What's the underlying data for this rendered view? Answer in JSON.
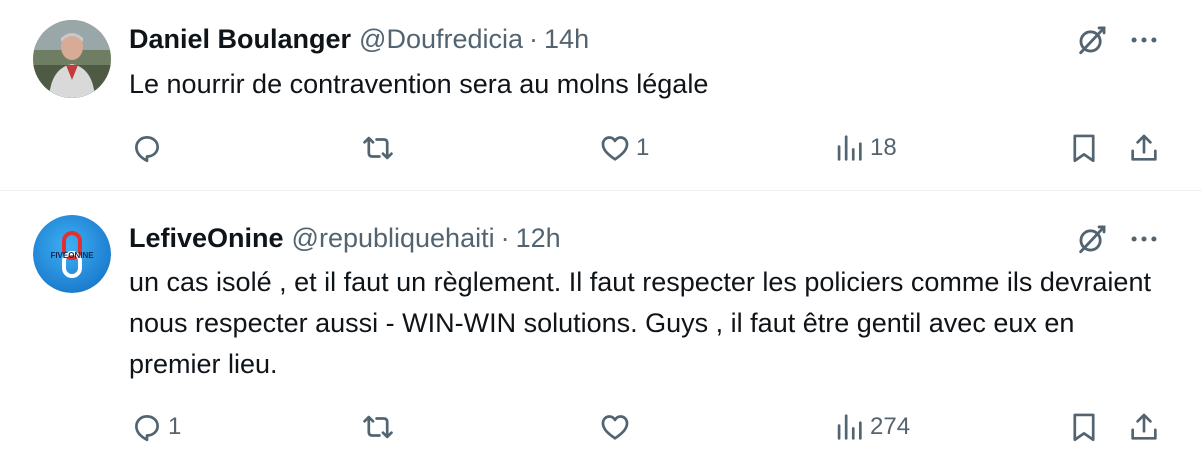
{
  "tweets": [
    {
      "display_name": "Daniel Boulanger",
      "handle": "@Doufredicia",
      "separator": "·",
      "time": "14h",
      "text": "Le nourrir de contravention sera au molns légale",
      "replies": "",
      "retweets": "",
      "likes": "1",
      "views": "18"
    },
    {
      "display_name": "LefiveOnine",
      "handle": "@republiquehaiti",
      "separator": "·",
      "time": "12h",
      "text": "un cas isolé , et il faut un règlement. Il faut respecter les policiers comme ils devraient nous respecter aussi - WIN-WIN solutions. Guys , il faut être gentil avec eux en premier lieu.",
      "replies": "1",
      "retweets": "",
      "likes": "",
      "views": "274",
      "avatar_logo": "FIVEONINE"
    }
  ],
  "icons": [
    "grok-icon",
    "more-icon",
    "reply-icon",
    "retweet-icon",
    "like-icon",
    "views-icon",
    "bookmark-icon",
    "share-icon"
  ],
  "colors": {
    "text": "#0f1419",
    "muted": "#536471",
    "divider": "#eff3f4",
    "logo_blue": "#1d9bf0",
    "logo_red": "#e0312e"
  }
}
